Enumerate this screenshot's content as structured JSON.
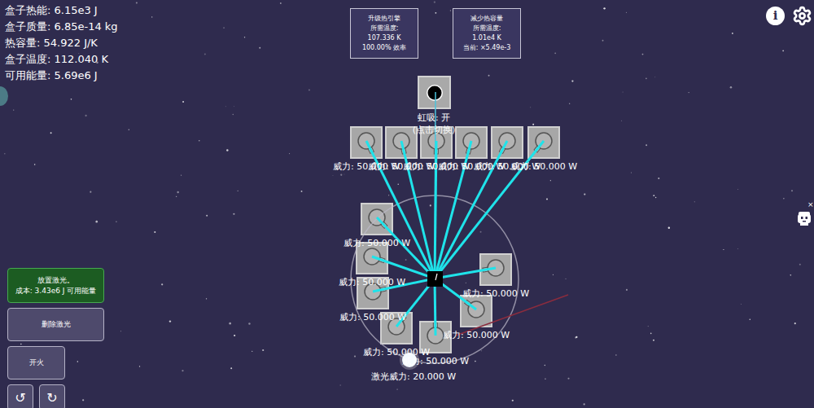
{
  "stats": [
    "盒子热能: 6.15e3 J",
    "盒子质量: 6.85e-14 kg",
    "热容量: 54.922 J/K",
    "盒子温度: 112.040 K",
    "可用能量: 5.69e6 J"
  ],
  "upgrades": [
    {
      "title": "升级热引擎",
      "lines": [
        "所需温度:",
        "107.336 K",
        "100.00% 效率"
      ]
    },
    {
      "title": "减少热容量",
      "lines": [
        "所需温度:",
        "1.01e4 K",
        "当前: ×5.49e-3"
      ]
    }
  ],
  "siphon": {
    "label": "虹吸: 开",
    "hint": "(点击切换)",
    "on": true
  },
  "lasers": [
    {
      "power": "威力: 50.000 W",
      "firing": true
    },
    {
      "power": "威力: 50.000 W",
      "firing": true
    },
    {
      "power": "威力: 50.000 W",
      "firing": true
    },
    {
      "power": "威力: 50.000 W",
      "firing": true
    },
    {
      "power": "威力: 50.000 W",
      "firing": true
    },
    {
      "power": "威力: 50.000 W",
      "firing": true
    },
    {
      "power": "威力: 50.000 W",
      "firing": true
    },
    {
      "power": "威力: 50.000 W",
      "firing": true
    },
    {
      "power": "威力: 50.000 W",
      "firing": true
    },
    {
      "power": "威力: 50.000 W",
      "firing": true
    },
    {
      "power": "威力: 50.000 W",
      "firing": true
    },
    {
      "power": "威力: 50.000 W",
      "firing": true
    },
    {
      "power": "威力: 50.000 W",
      "firing": true
    }
  ],
  "laser_power": "激光威力: 20.000 W",
  "tools": [
    {
      "label": "放置激光。",
      "sub": "成本: 3.43e6 J 可用能量",
      "kind": "place",
      "selected": true
    },
    {
      "label": "删除激光",
      "kind": "delete",
      "selected": false
    },
    {
      "label": "开火",
      "kind": "fire",
      "selected": false
    }
  ],
  "history": [
    "↺",
    "↻"
  ],
  "top_right": {
    "info": "i"
  },
  "mascot": {
    "close": "×"
  }
}
